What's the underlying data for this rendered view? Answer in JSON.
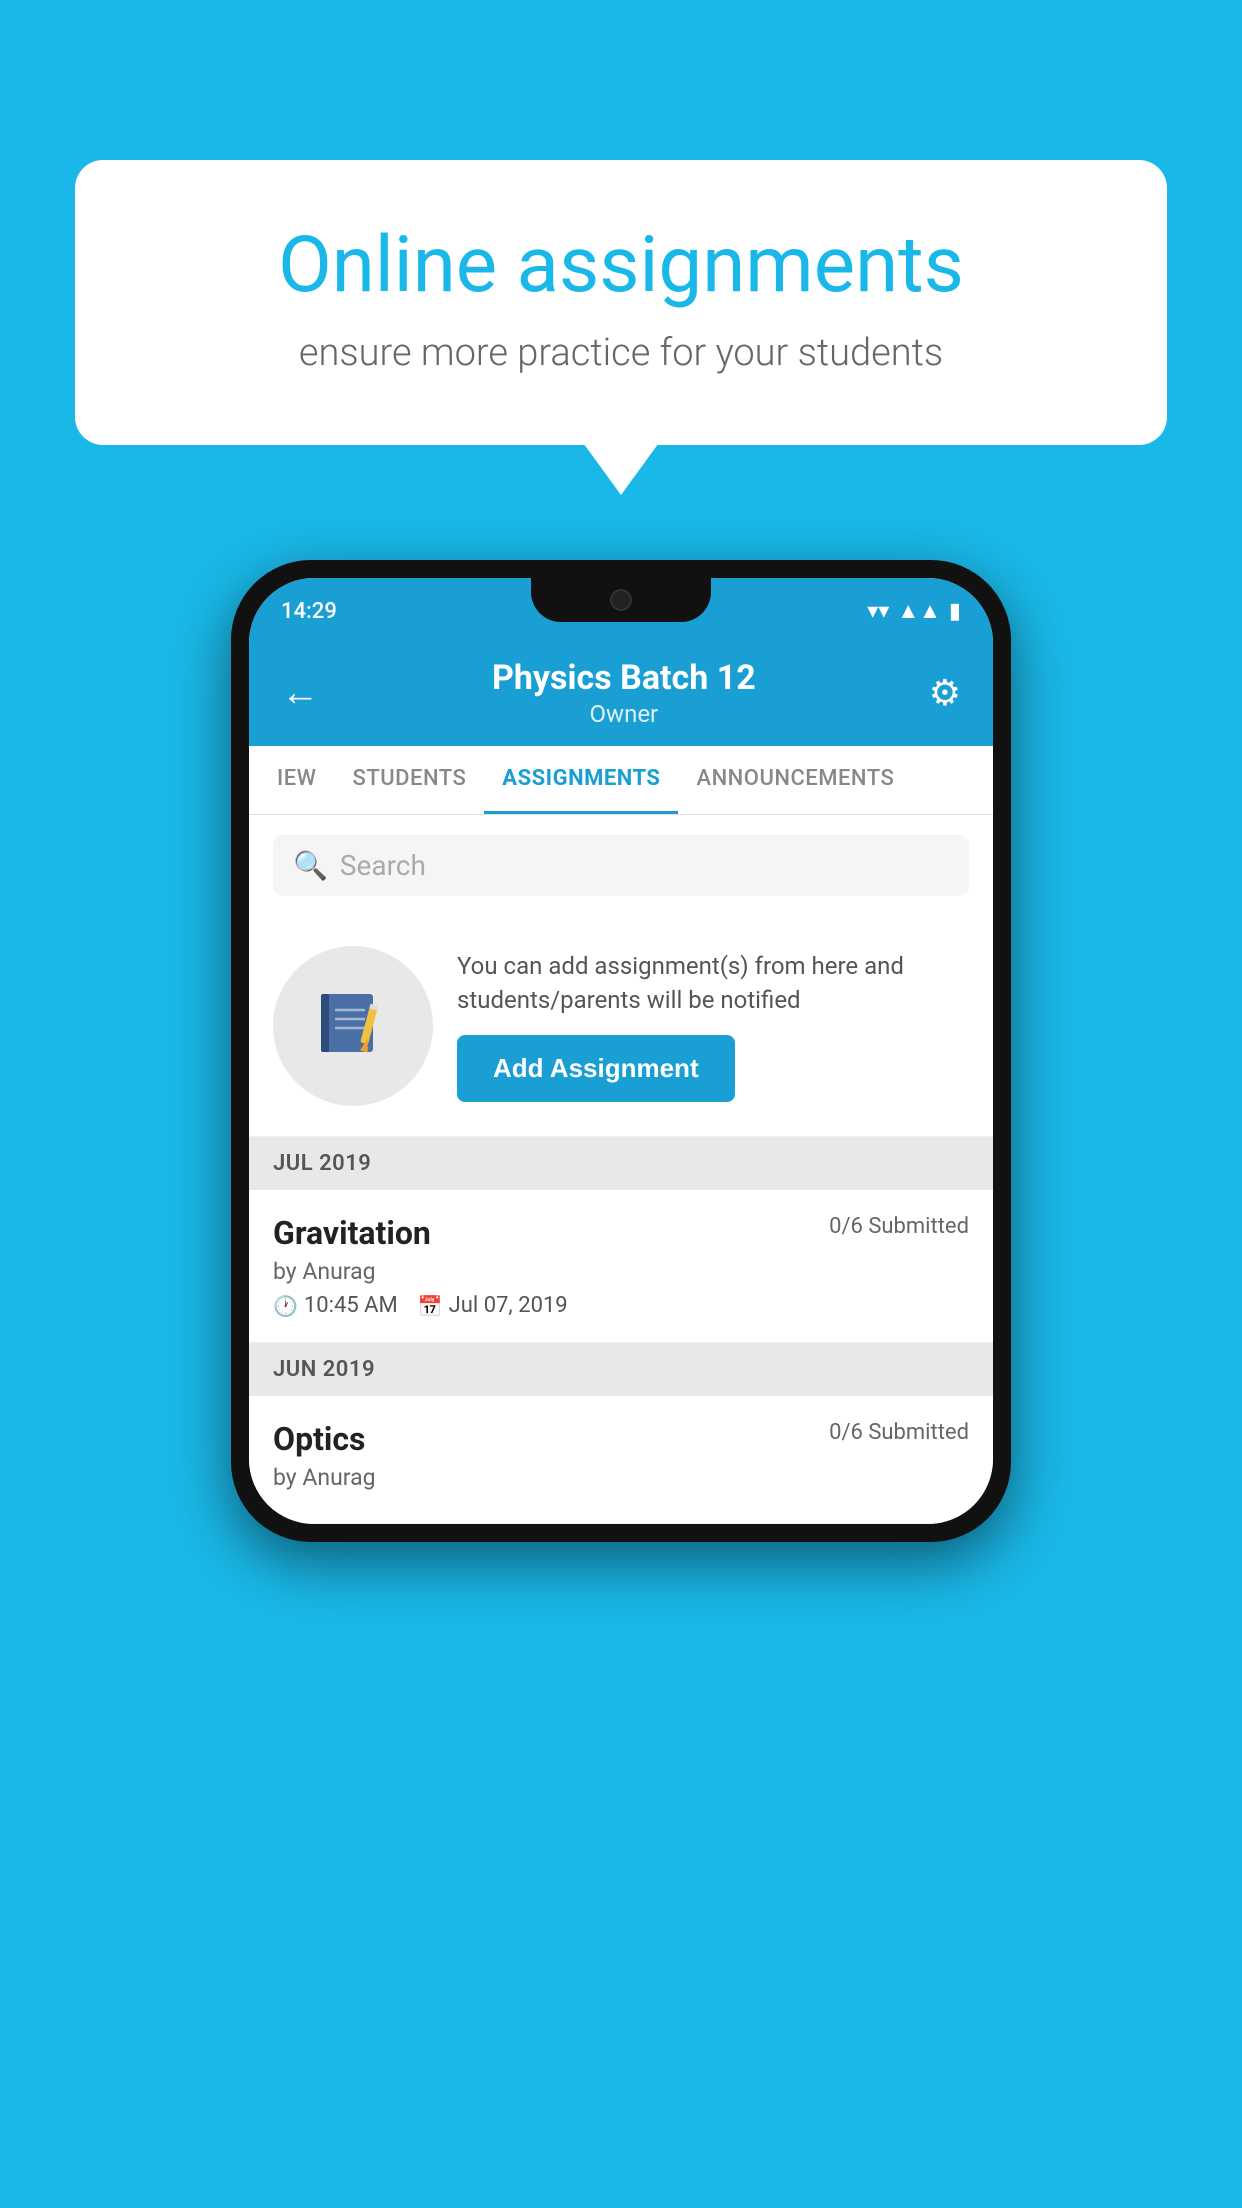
{
  "background_color": "#1ab8e8",
  "speech_bubble": {
    "title": "Online assignments",
    "subtitle": "ensure more practice for your students"
  },
  "phone": {
    "status_bar": {
      "time": "14:29"
    },
    "header": {
      "title": "Physics Batch 12",
      "subtitle": "Owner",
      "back_label": "←",
      "settings_label": "⚙"
    },
    "tabs": [
      {
        "label": "IEW",
        "active": false
      },
      {
        "label": "STUDENTS",
        "active": false
      },
      {
        "label": "ASSIGNMENTS",
        "active": true
      },
      {
        "label": "ANNOUNCEMENTS",
        "active": false
      }
    ],
    "search": {
      "placeholder": "Search"
    },
    "promo": {
      "text": "You can add assignment(s) from here and students/parents will be notified",
      "button_label": "Add Assignment"
    },
    "sections": [
      {
        "month": "JUL 2019",
        "assignments": [
          {
            "name": "Gravitation",
            "submitted": "0/6 Submitted",
            "by": "by Anurag",
            "time": "10:45 AM",
            "date": "Jul 07, 2019"
          }
        ]
      },
      {
        "month": "JUN 2019",
        "assignments": [
          {
            "name": "Optics",
            "submitted": "0/6 Submitted",
            "by": "by Anurag",
            "time": "",
            "date": ""
          }
        ]
      }
    ]
  }
}
